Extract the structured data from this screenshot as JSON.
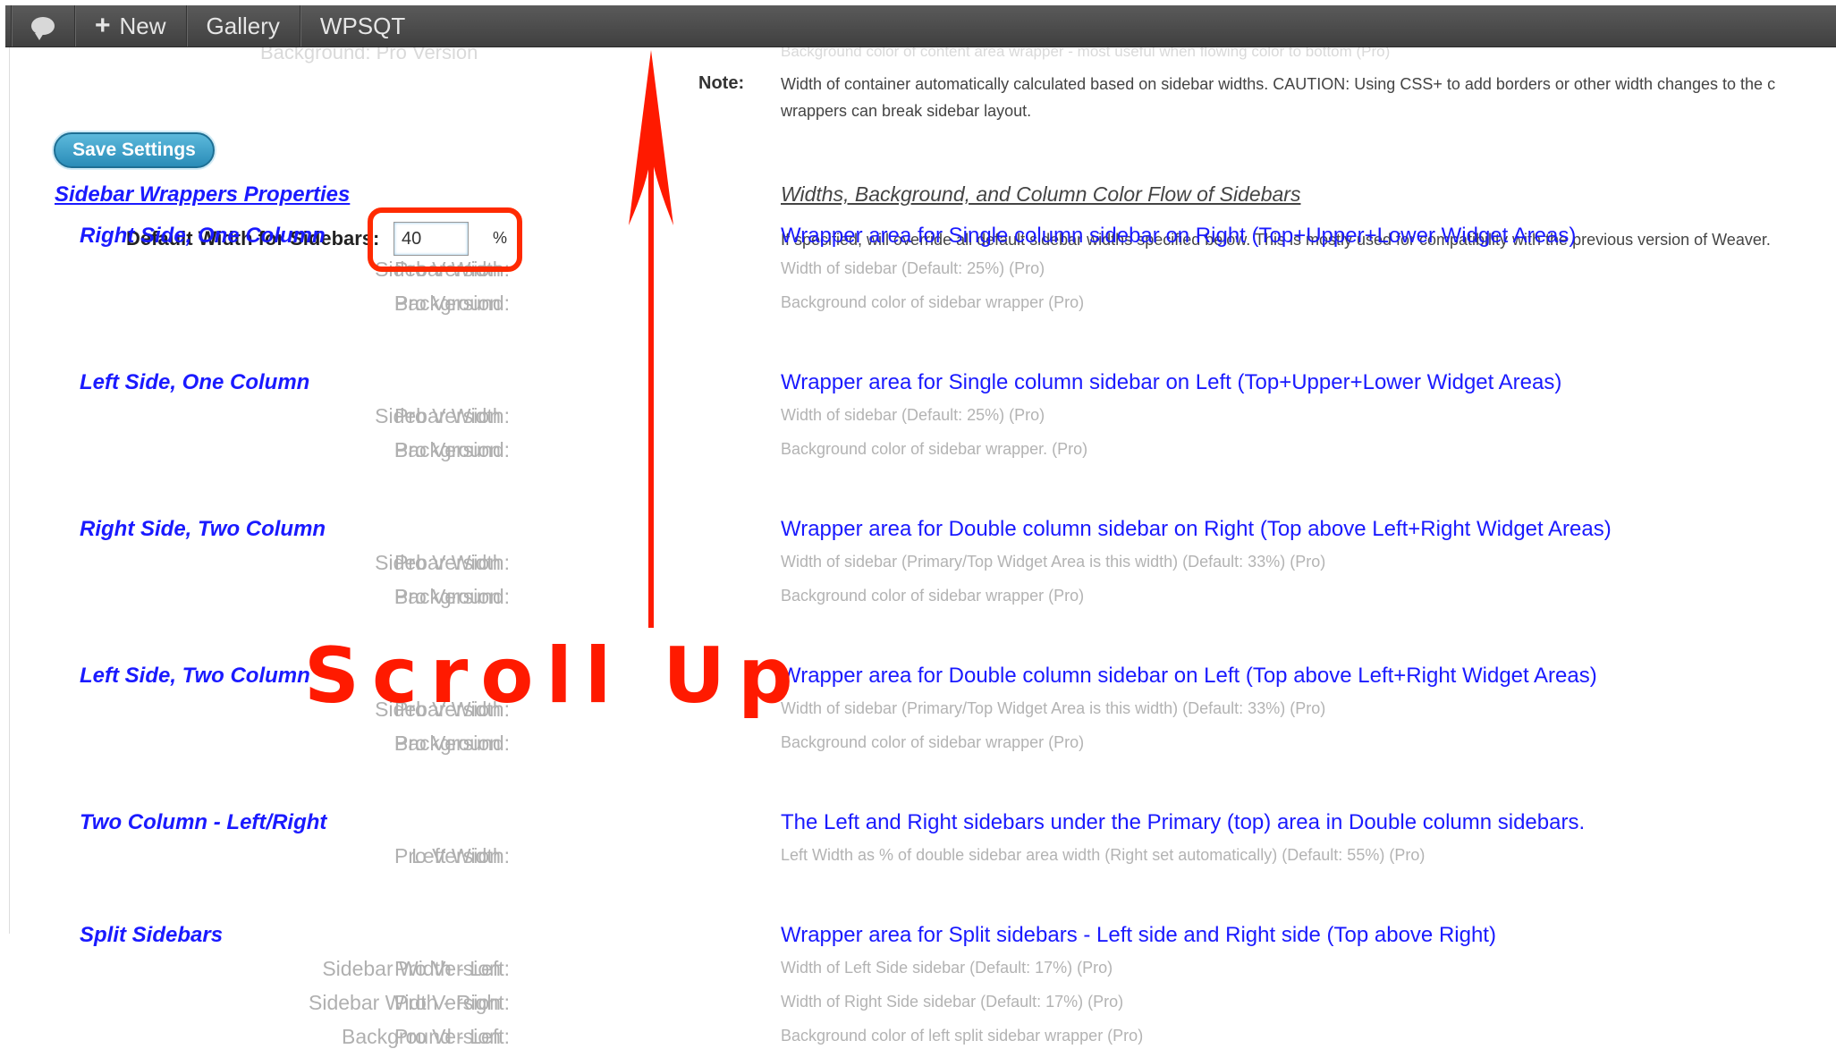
{
  "adminbar": {
    "new_label": "New",
    "gallery_label": "Gallery",
    "plugin_label": "WPSQT"
  },
  "top": {
    "faded_left": "Background:  Pro Version",
    "faded_right": "Background color of content area wrapper - most useful when flowing color to bottom (Pro)",
    "note_label": "Note:",
    "note_line1": "Width of container automatically calculated based on sidebar widths. CAUTION: Using CSS+ to add borders or other width changes to the c",
    "note_line2": "wrappers can break sidebar layout."
  },
  "save_label": "Save Settings",
  "section": {
    "title": "Sidebar Wrappers Properties",
    "right_title": "Widths, Background, and Column Color Flow of Sidebars"
  },
  "default_width": {
    "label": "Default Width for Sidebars:",
    "value": "40",
    "unit": "%",
    "desc": "If specified, will override all default sidebar widths specified below. This is mostly used for compatibility with the previous version of Weaver."
  },
  "groups": [
    {
      "heading": "Right Side, One Column",
      "heading_desc": "Wrapper area for Single column sidebar on Right (Top+Upper+Lower Widget Areas)",
      "rows": [
        {
          "label": "Sidebar Width:",
          "value": "Pro Version",
          "desc": "Width of sidebar (Default: 25%) (Pro)"
        },
        {
          "label": "Background:",
          "value": "Pro Version",
          "desc": "Background color of sidebar wrapper (Pro)"
        }
      ]
    },
    {
      "heading": "Left Side, One Column",
      "heading_desc": "Wrapper area for Single column sidebar on Left (Top+Upper+Lower Widget Areas)",
      "rows": [
        {
          "label": "Sidebar Width:",
          "value": "Pro Version",
          "desc": "Width of sidebar (Default: 25%) (Pro)"
        },
        {
          "label": "Background:",
          "value": "Pro Version",
          "desc": "Background color of sidebar wrapper. (Pro)"
        }
      ]
    },
    {
      "heading": "Right Side, Two Column",
      "heading_desc": "Wrapper area for Double column sidebar on Right (Top above Left+Right Widget Areas)",
      "rows": [
        {
          "label": "Sidebar Width:",
          "value": "Pro Version",
          "desc": "Width of sidebar (Primary/Top Widget Area is this width) (Default: 33%) (Pro)"
        },
        {
          "label": "Background:",
          "value": "Pro Version",
          "desc": "Background color of sidebar wrapper (Pro)"
        }
      ]
    },
    {
      "heading": "Left Side, Two Column",
      "heading_desc": "Wrapper area for Double column sidebar on Left (Top above Left+Right Widget Areas)",
      "rows": [
        {
          "label": "Sidebar Width:",
          "value": "Pro Version",
          "desc": "Width of sidebar (Primary/Top Widget Area is this width) (Default: 33%) (Pro)"
        },
        {
          "label": "Background:",
          "value": "Pro Version",
          "desc": "Background color of sidebar wrapper (Pro)"
        }
      ]
    },
    {
      "heading": "Two Column - Left/Right",
      "heading_desc": "The Left and Right sidebars under the Primary (top) area in Double column sidebars.",
      "rows": [
        {
          "label": "Left Width:",
          "value": "Pro Version",
          "desc": "Left Width as % of double sidebar area width (Right set automatically) (Default: 55%) (Pro)"
        }
      ]
    },
    {
      "heading": "Split Sidebars",
      "heading_desc": "Wrapper area for Split sidebars - Left side and Right side (Top above Right)",
      "rows": [
        {
          "label": "Sidebar Width - Left:",
          "value": "Pro Version",
          "desc": "Width of Left Side sidebar (Default: 17%) (Pro)"
        },
        {
          "label": "Sidebar Width - Right:",
          "value": "Pro Version",
          "desc": "Width of Right Side sidebar (Default: 17%) (Pro)"
        },
        {
          "label": "Background - Left:",
          "value": "Pro Version",
          "desc": "Background color of left split sidebar wrapper (Pro)"
        }
      ]
    }
  ],
  "annotation": {
    "text": "Scroll Up",
    "color": "#ff1a00",
    "arrow_icon": "up-arrow-icon"
  }
}
